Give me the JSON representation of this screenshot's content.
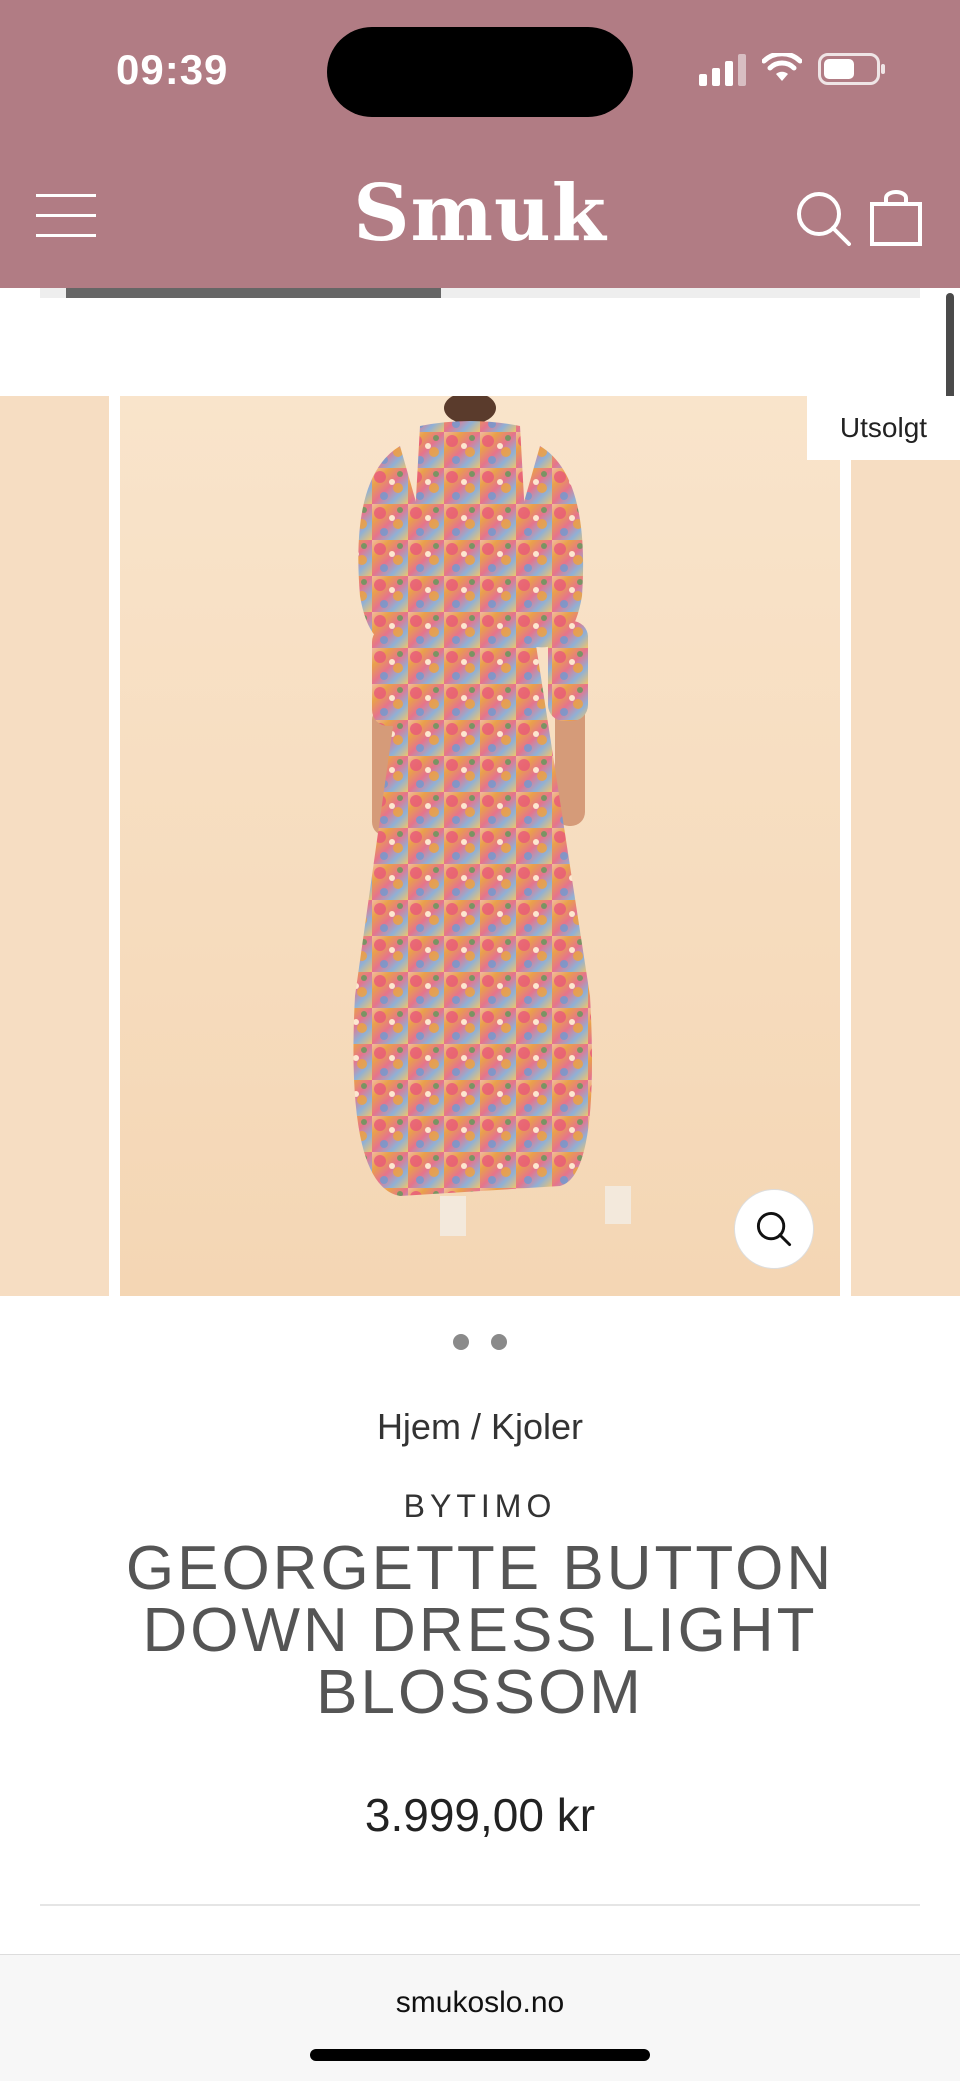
{
  "status_bar": {
    "time": "09:39",
    "icons": [
      "signal-icon",
      "wifi-icon",
      "battery-icon"
    ]
  },
  "header": {
    "logo": "Smuk",
    "icons": [
      "menu-icon",
      "search-icon",
      "cart-icon"
    ],
    "background_color": "#b17c84"
  },
  "gallery": {
    "badge": "Utsolgt",
    "image_alt": "Floral maxi dress, back view",
    "dots_count": 2
  },
  "product": {
    "breadcrumb_home": "Hjem",
    "breadcrumb_sep": "/",
    "breadcrumb_category": "Kjoler",
    "brand": "BYTIMO",
    "title": "GEORGETTE BUTTON DOWN DRESS LIGHT BLOSSOM",
    "price": "3.999,00 kr"
  },
  "browser": {
    "url": "smukoslo.no"
  }
}
